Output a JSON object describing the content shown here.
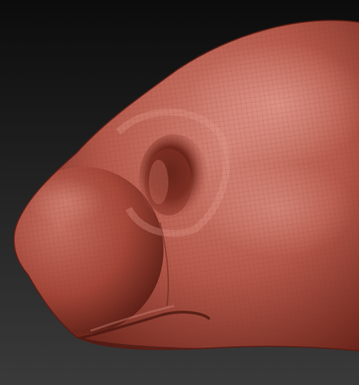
{
  "scene": {
    "subject": "sculpted-animal-head-mesh",
    "colors": {
      "background_top": "#0c0c0c",
      "background_bottom": "#3a3a3a",
      "clay_light": "#d38476",
      "clay_mid": "#b5584a",
      "clay_dark": "#6e261c",
      "clay_shadow": "#3e130d",
      "wire": "#7d3227"
    }
  }
}
